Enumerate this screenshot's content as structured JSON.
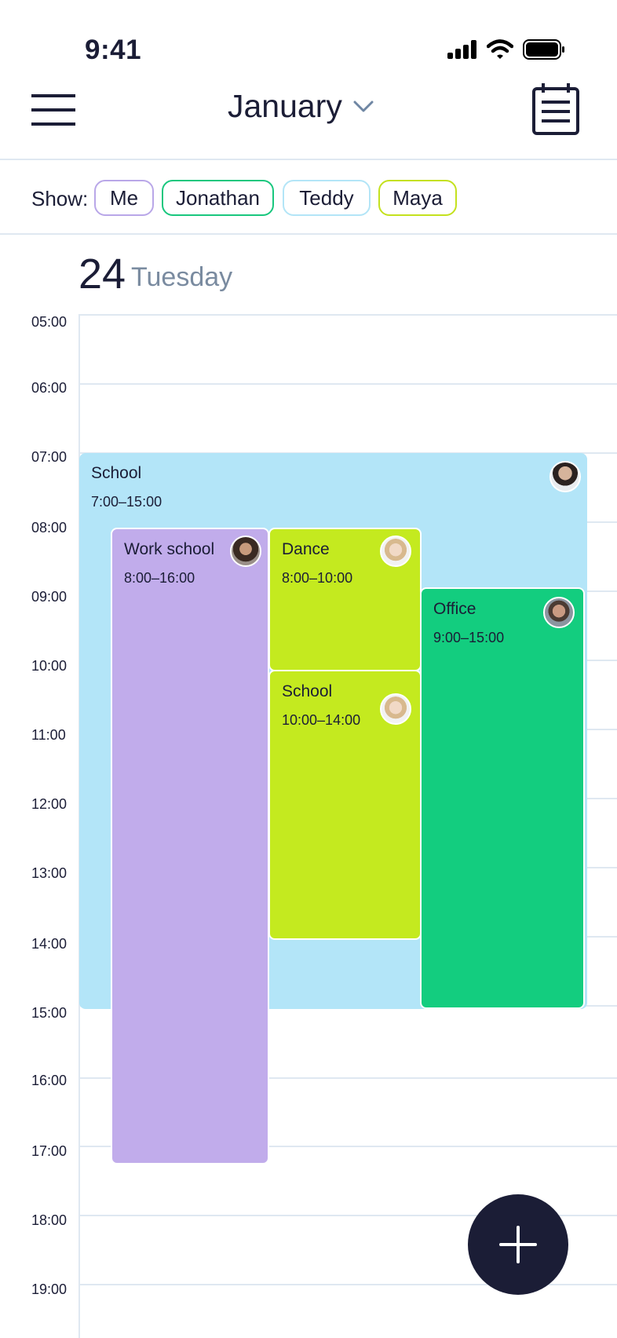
{
  "status_bar": {
    "time": "9:41"
  },
  "header": {
    "month": "January"
  },
  "filters": {
    "label": "Show:",
    "chips": [
      {
        "label": "Me",
        "color": "#b9a7e8"
      },
      {
        "label": "Jonathan",
        "color": "#19c77e"
      },
      {
        "label": "Teddy",
        "color": "#b3e5f7"
      },
      {
        "label": "Maya",
        "color": "#c4e11e"
      }
    ]
  },
  "date": {
    "day_number": "24",
    "weekday": "Tuesday"
  },
  "hours": [
    "05:00",
    "06:00",
    "07:00",
    "08:00",
    "09:00",
    "10:00",
    "11:00",
    "12:00",
    "13:00",
    "14:00",
    "15:00",
    "16:00",
    "17:00",
    "18:00",
    "19:00"
  ],
  "events": [
    {
      "title": "School",
      "time": "7:00–15:00",
      "color": "#b3e5f8",
      "person": "Teddy"
    },
    {
      "title": "Work school",
      "time": "8:00–16:00",
      "color": "#c1aceb",
      "person": "Me"
    },
    {
      "title": "Dance",
      "time": "8:00–10:00",
      "color": "#c4ea1f",
      "person": "Maya"
    },
    {
      "title": "School",
      "time": "10:00–14:00",
      "color": "#c4ea1f",
      "person": "Maya"
    },
    {
      "title": "Office",
      "time": "9:00–15:00",
      "color": "#13cd7f",
      "person": "Jonathan"
    }
  ]
}
